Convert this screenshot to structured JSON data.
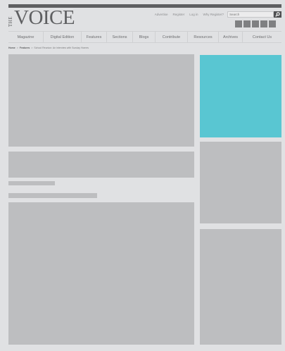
{
  "header": {
    "logo_the": "THE",
    "logo_voice": "VOICE",
    "utility_links": [
      "Advertise",
      "Register",
      "Log in",
      "Why Register?"
    ],
    "search_placeholder": "Search",
    "social_icons": [
      "facebook-icon",
      "flickr-icon",
      "vimeo-icon",
      "linkedin-icon",
      "rss-icon"
    ]
  },
  "nav": {
    "items": [
      "Magazine",
      "Digital Edition",
      "Features",
      "Sections",
      "Blogs",
      "Contribute",
      "Resources",
      "Archives",
      "Contact Us"
    ]
  },
  "breadcrumb": {
    "items": [
      "Home",
      "Features",
      "School Reunion: An interview with Sunday Homes"
    ]
  },
  "colors": {
    "accent": "#59c6d2",
    "placeholder": "#bdbec0",
    "background": "#e0e1e3",
    "header_bar": "#5e5f61"
  }
}
